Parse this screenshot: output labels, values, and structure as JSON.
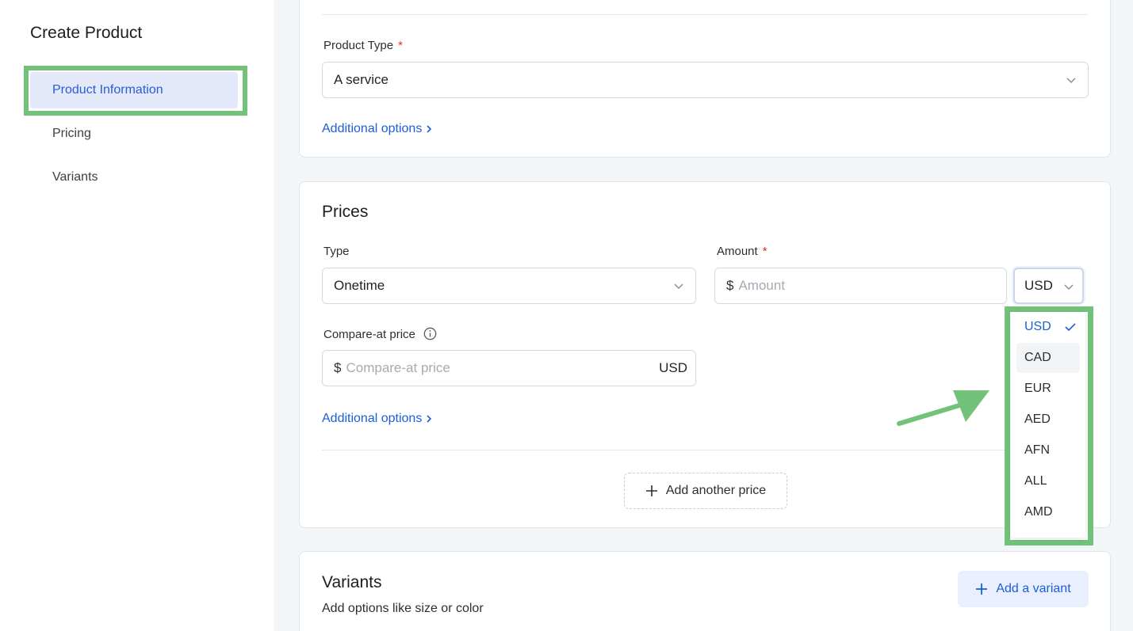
{
  "sidebar": {
    "title": "Create Product",
    "items": [
      {
        "label": "Product Information",
        "active": true
      },
      {
        "label": "Pricing",
        "active": false
      },
      {
        "label": "Variants",
        "active": false
      }
    ]
  },
  "product_info": {
    "type_label": "Product Type",
    "required_mark": "*",
    "type_value": "A service",
    "additional_options": "Additional options"
  },
  "prices": {
    "title": "Prices",
    "type_label": "Type",
    "type_value": "Onetime",
    "amount_label": "Amount",
    "required_mark": "*",
    "amount_prefix": "$",
    "amount_placeholder": "Amount",
    "currency_value": "USD",
    "compare_label": "Compare-at price",
    "compare_prefix": "$",
    "compare_placeholder": "Compare-at price",
    "compare_suffix": "USD",
    "additional_options": "Additional options",
    "add_another_price": "Add another price"
  },
  "currency_dropdown": {
    "options": [
      "USD",
      "CAD",
      "EUR",
      "AED",
      "AFN",
      "ALL",
      "AMD"
    ],
    "selected": "USD",
    "hovered": "CAD"
  },
  "variants": {
    "title": "Variants",
    "subtitle": "Add options like size or color",
    "add_button": "Add a variant"
  },
  "colors": {
    "accent": "#1b5fd6",
    "highlight": "#72c27a",
    "required": "#d93025"
  }
}
